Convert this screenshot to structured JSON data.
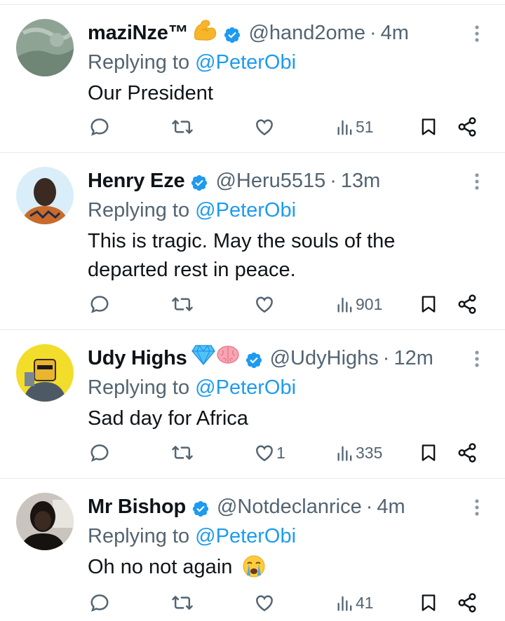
{
  "colors": {
    "link": "#1d9bf0",
    "verified": "#1d9bf0",
    "secondary_text": "#536471",
    "primary_text": "#0f1419",
    "divider": "#e6e9ec"
  },
  "replies": [
    {
      "name": "maziNze™",
      "emoji": "flexed-biceps",
      "handle": "@hand2ome",
      "separator": "·",
      "time": "4m",
      "replying_prefix": "Replying to",
      "replying_to": "@PeterObi",
      "text": "Our President",
      "likes": "",
      "views": "51"
    },
    {
      "name": "Henry Eze",
      "handle": "@Heru5515",
      "separator": "·",
      "time": "13m",
      "replying_prefix": "Replying to",
      "replying_to": "@PeterObi",
      "text": "This is tragic. May the souls of the departed rest in peace.",
      "likes": "",
      "views": "901"
    },
    {
      "name": "Udy Highs",
      "emoji": "gem-and-brain",
      "handle": "@UdyHighs",
      "separator": "·",
      "time": "12m",
      "replying_prefix": "Replying to",
      "replying_to": "@PeterObi",
      "text": "Sad day for Africa",
      "likes": "1",
      "views": "335"
    },
    {
      "name": "Mr Bishop",
      "handle": "@Notdeclanrice",
      "separator": "·",
      "time": "4m",
      "replying_prefix": "Replying to",
      "replying_to": "@PeterObi",
      "text": "Oh no not again",
      "text_emoji": "loudly-crying-face",
      "likes": "",
      "views": "41"
    }
  ],
  "icons": {
    "reply": "reply-icon",
    "retweet": "retweet-icon",
    "like": "heart-icon",
    "views": "views-icon",
    "bookmark": "bookmark-icon",
    "share": "share-icon",
    "more": "more-icon",
    "verified": "verified-badge-icon"
  }
}
